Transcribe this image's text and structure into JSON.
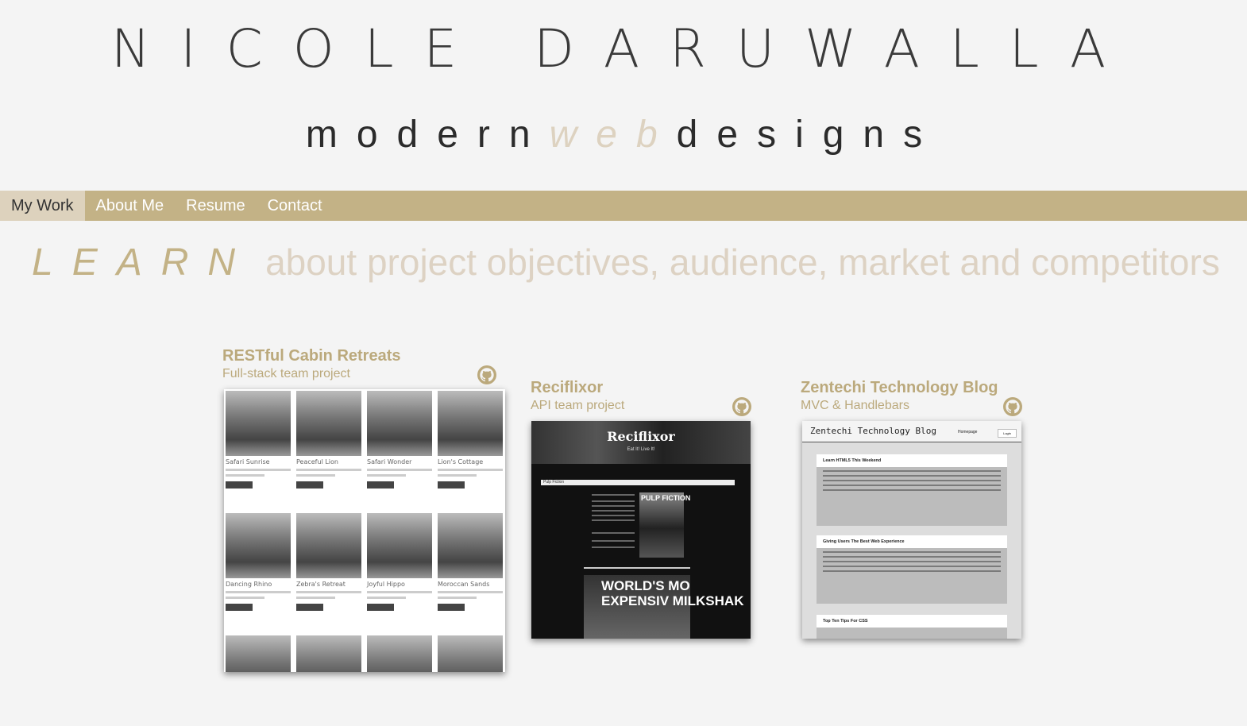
{
  "header": {
    "name": "NICOLE DARUWALLA",
    "tagline_pre": "modern",
    "tagline_web": "web",
    "tagline_post": "designs"
  },
  "nav": {
    "items": [
      {
        "label": "My Work",
        "active": true
      },
      {
        "label": "About Me",
        "active": false
      },
      {
        "label": "Resume",
        "active": false
      },
      {
        "label": "Contact",
        "active": false
      }
    ]
  },
  "banner": {
    "word": "LEARN",
    "text": "about project objectives, audience, market and competitors"
  },
  "projects": [
    {
      "title": "RESTful Cabin Retreats",
      "subtitle": "Full-stack team project",
      "icon": "github-icon",
      "listings": [
        "Safari Sunrise",
        "Peaceful Lion",
        "Safari Wonder",
        "Lion's Cottage",
        "Dancing Rhino",
        "Zebra's Retreat",
        "Joyful Hippo",
        "Moroccan Sands"
      ],
      "button_label": "View Details"
    },
    {
      "title": "Reciflixor",
      "subtitle": "API team project",
      "icon": "github-icon",
      "app_title": "Reciflixor",
      "app_tagline": "Eat It! Live It!",
      "search_value": "Pulp Fiction",
      "poster_title": "PULP FICTION",
      "feature_title": "WORLD'S MO EXPENSIV MILKSHAK"
    },
    {
      "title": "Zentechi Technology Blog",
      "subtitle": "MVC & Handlebars",
      "icon": "github-icon",
      "app_title": "Zentechi Technology Blog",
      "nav_home": "Homepage",
      "nav_login": "Login",
      "posts": [
        "Learn HTML5 This Weekend",
        "Giving Users The Best Web Experience",
        "Top Ten Tips For CSS"
      ]
    }
  ],
  "colors": {
    "accent": "#c3b286",
    "accent_light": "#ddd2bd",
    "background": "#f4f4f4",
    "text_dark": "#3a3a3a"
  }
}
